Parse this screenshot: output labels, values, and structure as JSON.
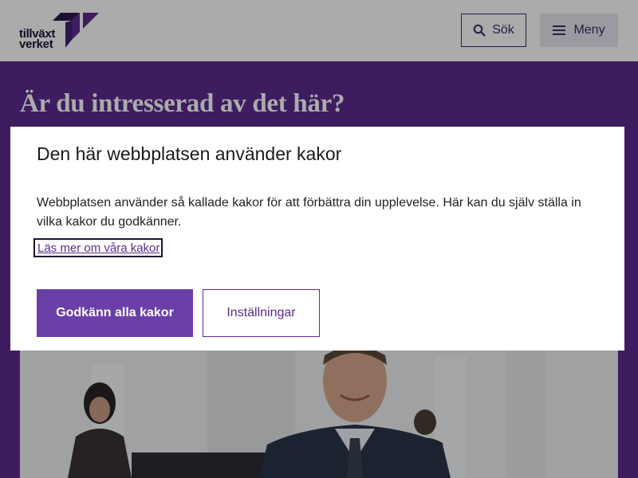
{
  "header": {
    "logo": {
      "line1": "tillväxt",
      "line2": "verket",
      "icon": "tillvaxtverket-logo-icon"
    },
    "search_label": "Sök",
    "search_icon": "search-icon",
    "menu_label": "Meny",
    "menu_icon": "hamburger-icon"
  },
  "hero": {
    "title": "Är du intresserad av det här?",
    "image": "photo-smiling-man-in-office"
  },
  "cookie_modal": {
    "title": "Den här webbplatsen använder kakor",
    "body": "Webbplatsen använder så kallade kakor för att förbättra din upplevelse. Här kan du själv ställa in vilka kakor du godkänner.",
    "link": "Läs mer om våra kakor",
    "accept_label": "Godkänn alla kakor",
    "settings_label": "Inställningar"
  },
  "colors": {
    "brand_purple": "#5b2b8e",
    "button_purple": "#6b3fa8",
    "dark_navy": "#1c1233"
  }
}
